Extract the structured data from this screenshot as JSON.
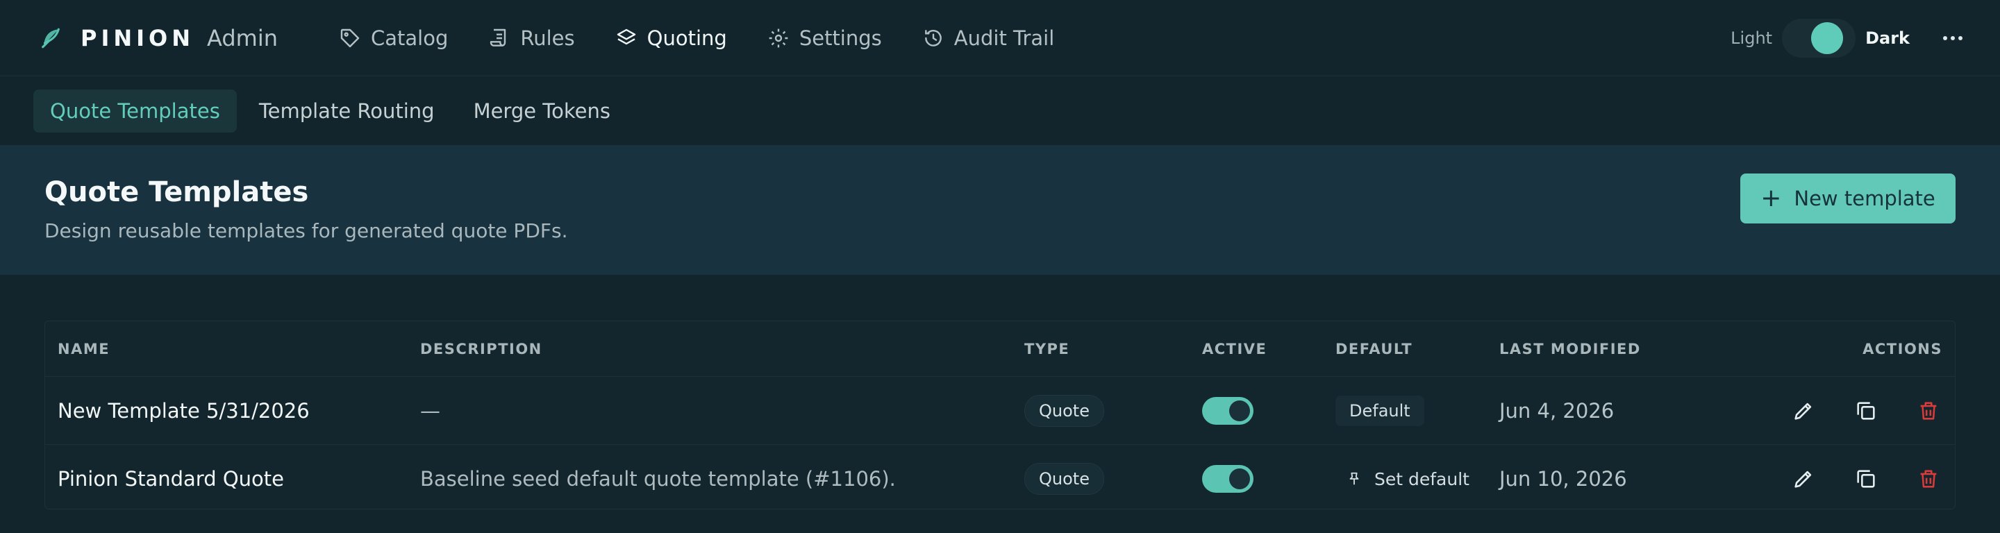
{
  "brand": {
    "name": "PINION",
    "subtitle": "Admin",
    "icon": "feather-icon"
  },
  "nav": {
    "items": [
      {
        "label": "Catalog",
        "icon": "tag-icon"
      },
      {
        "label": "Rules",
        "icon": "scroll-icon"
      },
      {
        "label": "Quoting",
        "icon": "layers-icon",
        "active": true
      },
      {
        "label": "Settings",
        "icon": "gear-icon"
      },
      {
        "label": "Audit Trail",
        "icon": "history-icon"
      }
    ]
  },
  "theme": {
    "light_label": "Light",
    "dark_label": "Dark",
    "selected": "Dark"
  },
  "subtabs": [
    {
      "label": "Quote Templates",
      "active": true
    },
    {
      "label": "Template Routing"
    },
    {
      "label": "Merge Tokens"
    }
  ],
  "page": {
    "title": "Quote Templates",
    "subtitle": "Design reusable templates for generated quote PDFs.",
    "new_button": "New template"
  },
  "table": {
    "headers": {
      "name": "NAME",
      "description": "DESCRIPTION",
      "type": "TYPE",
      "active": "ACTIVE",
      "default": "DEFAULT",
      "modified": "LAST MODIFIED",
      "actions": "ACTIONS"
    },
    "rows": [
      {
        "name": "New Template 5/31/2026",
        "description": "—",
        "type": "Quote",
        "active": true,
        "default": "Default",
        "modified": "Jun 4, 2026"
      },
      {
        "name": "Pinion Standard Quote",
        "description": "Baseline seed default quote template (#1106).",
        "type": "Quote",
        "active": true,
        "default": "Set default",
        "modified": "Jun 10, 2026"
      }
    ]
  },
  "colors": {
    "accent": "#62c9b8",
    "background": "#13252c",
    "hero": "#18323f",
    "danger": "#d93b3b"
  }
}
